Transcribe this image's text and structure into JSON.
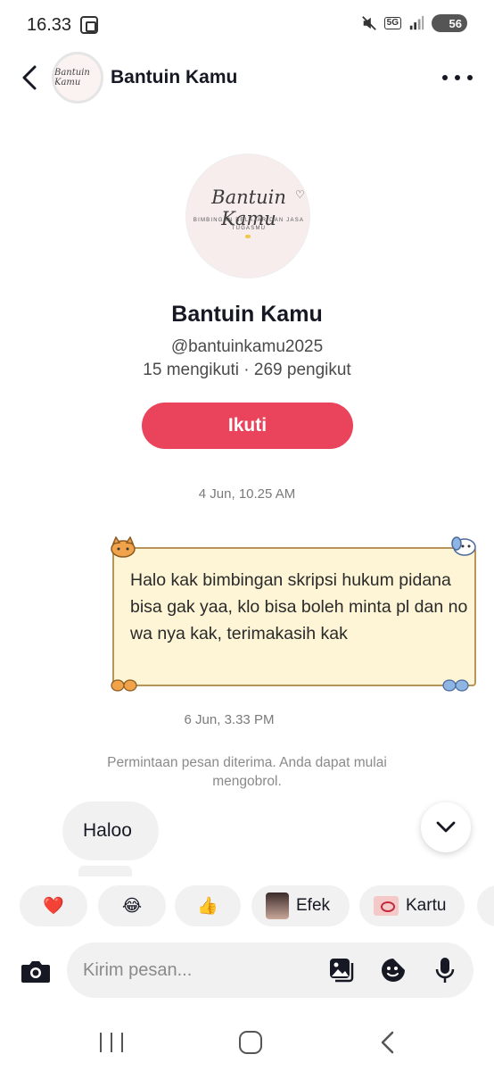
{
  "status_bar": {
    "time": "16.33",
    "network": "5G",
    "battery": "56"
  },
  "header": {
    "title": "Bantuin Kamu",
    "avatar_logo": "Bantuin Kamu"
  },
  "profile": {
    "logo_script": "Bantuin Kamu",
    "logo_tagline_1": "BIMBINGAN BELAJAR DAN JASA",
    "logo_tagline_2": "TUGASMU",
    "name": "Bantuin Kamu",
    "handle": "@bantuinkamu2025",
    "stats": "15 mengikuti · 269 pengikut",
    "follow_label": "Ikuti"
  },
  "messages": {
    "timestamp_1": "4 Jun, 10.25 AM",
    "outgoing_text": "Halo kak bimbingan skripsi hukum pidana bisa gak yaa, klo bisa boleh minta pl dan no wa nya kak, terimakasih kak",
    "timestamp_2": "6 Jun, 3.33 PM",
    "system_note": "Permintaan pesan diterima. Anda dapat mulai mengobrol.",
    "incoming_text": "Haloo"
  },
  "quick_reactions": {
    "heart": "❤️",
    "laugh": "😂",
    "thumbs_up": "👍",
    "efek_label": "Efek",
    "kartu_label": "Kartu"
  },
  "composer": {
    "placeholder": "Kirim pesan..."
  },
  "colors": {
    "accent": "#ea435c",
    "bubble_bg": "#fdf5d5",
    "bubble_border": "#b7955a",
    "chip_bg": "#f1f1f2"
  }
}
